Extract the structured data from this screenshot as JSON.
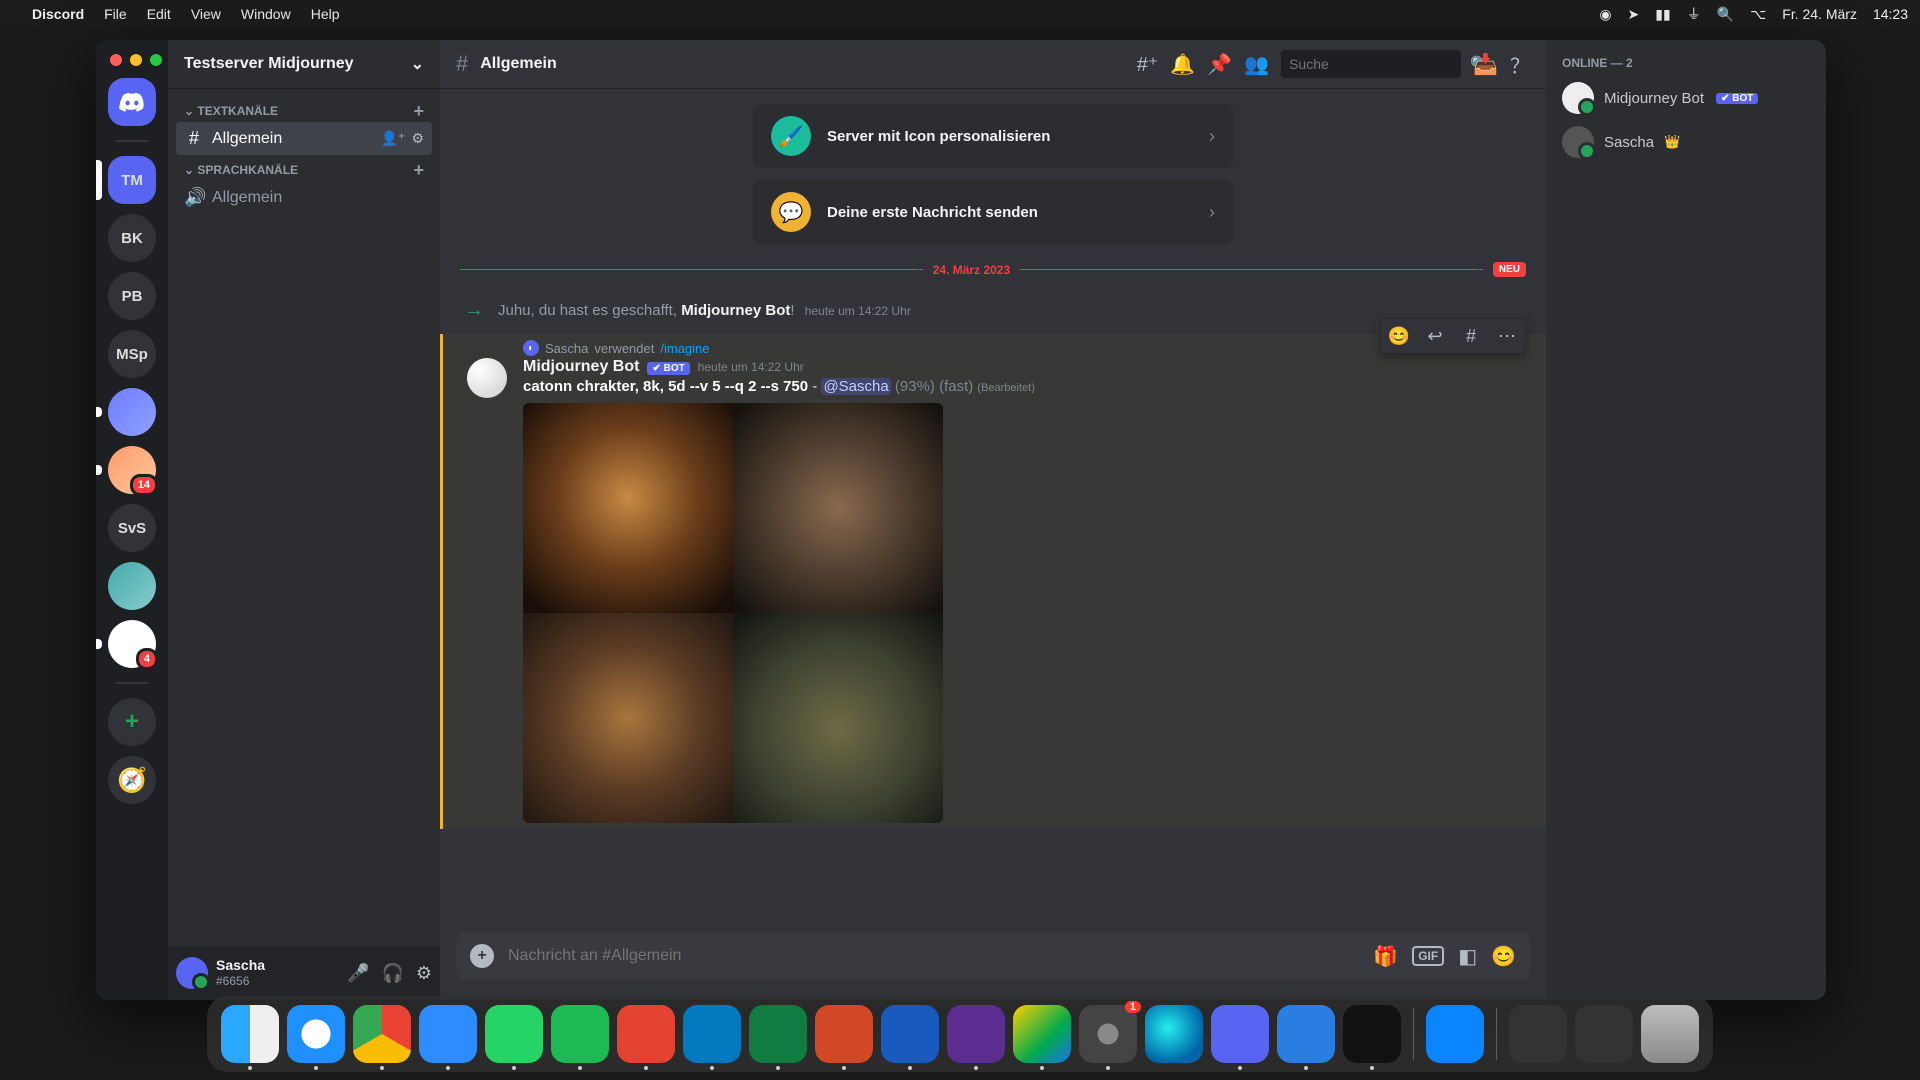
{
  "mac_menu": {
    "app": "Discord",
    "items": [
      "File",
      "Edit",
      "View",
      "Window",
      "Help"
    ],
    "date": "Fr. 24. März",
    "time": "14:23"
  },
  "server_rail": {
    "servers": [
      {
        "label": "TM",
        "active": true,
        "badge": null
      },
      {
        "label": "BK"
      },
      {
        "label": "PB"
      },
      {
        "label": "MSp"
      },
      {
        "label": "",
        "img": "img1"
      },
      {
        "label": "",
        "img": "img2",
        "badge": "14"
      },
      {
        "label": "SvS"
      },
      {
        "label": "",
        "img": "img3"
      },
      {
        "label": "",
        "img": "img4",
        "badge": "4"
      }
    ]
  },
  "sidebar": {
    "server_name": "Testserver Midjourney",
    "text_cat": "TEXTKANÄLE",
    "voice_cat": "SPRACHKANÄLE",
    "text_channels": [
      {
        "name": "Allgemein",
        "active": true
      }
    ],
    "voice_channels": [
      {
        "name": "Allgemein"
      }
    ],
    "user": {
      "name": "Sascha",
      "discriminator": "#6656"
    }
  },
  "top": {
    "channel": "Allgemein",
    "search_placeholder": "Suche"
  },
  "cards": {
    "personalize": "Server mit Icon personalisieren",
    "first_msg": "Deine erste Nachricht senden"
  },
  "divider": {
    "date": "24. März 2023",
    "badge": "NEU"
  },
  "system": {
    "prefix": "Juhu, du hast es geschafft, ",
    "name": "Midjourney Bot",
    "suffix": "!",
    "time": "heute um 14:22 Uhr"
  },
  "message": {
    "reply_user": "Sascha",
    "reply_verb": "verwendet",
    "reply_cmd": "/imagine",
    "author": "Midjourney Bot",
    "bot_tag": "✔ BOT",
    "timestamp": "heute um 14:22 Uhr",
    "prompt": "catonn chrakter, 8k, 5d --v 5 --q 2 --s 750",
    "mention": "@Sascha",
    "progress": "(93%) (fast)",
    "edited": "(Bearbeitet)"
  },
  "input": {
    "placeholder": "Nachricht an #Allgemein",
    "gif": "GIF"
  },
  "members": {
    "header": "ONLINE — 2",
    "list": [
      {
        "name": "Midjourney Bot",
        "bot": true
      },
      {
        "name": "Sascha",
        "owner": true
      }
    ],
    "bot_tag": "✔ BOT"
  },
  "dock_badge_settings": "1"
}
